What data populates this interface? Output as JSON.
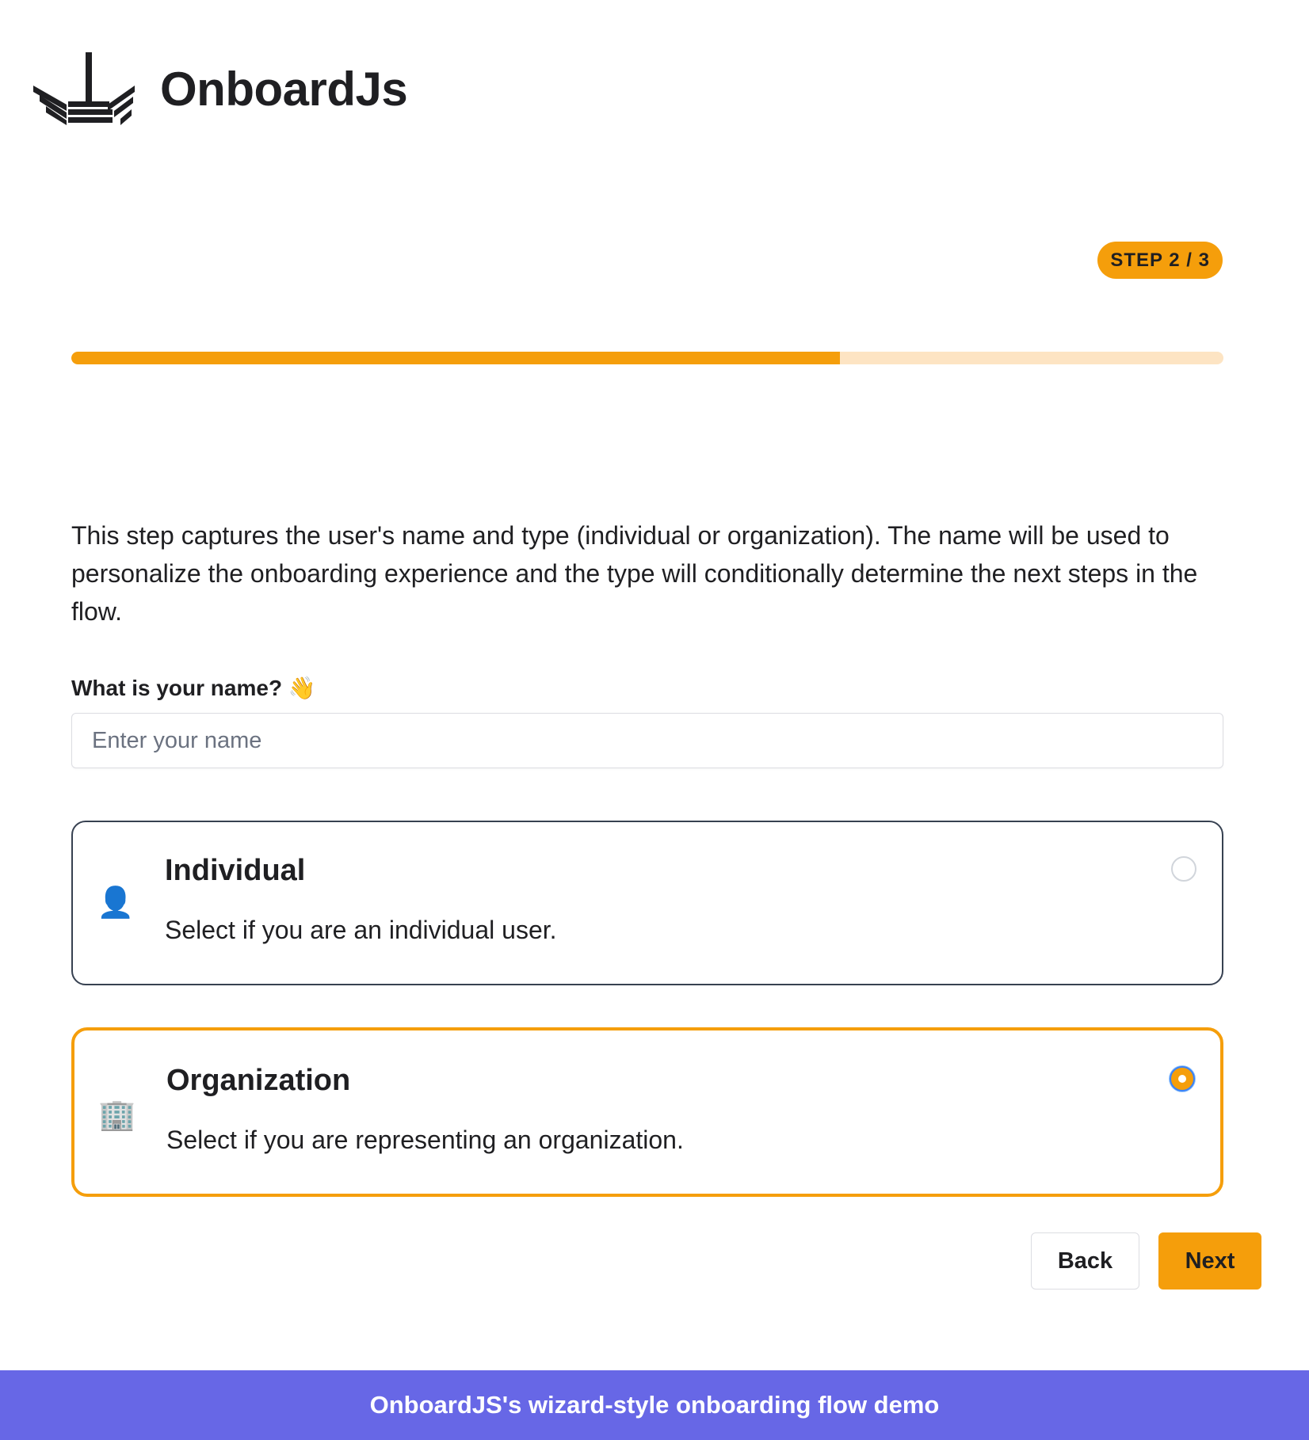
{
  "header": {
    "brand": "OnboardJs",
    "logo_icon": "ship-logo-icon"
  },
  "step": {
    "label": "STEP 2 / 3",
    "progress_fraction": 0.667
  },
  "colors": {
    "accent": "#f59e0b",
    "accent_light": "#fde4c3",
    "footer": "#6767e6",
    "text": "#1f1f22"
  },
  "description": "This step captures the user's name and type (individual or organization). The name will be used to personalize the onboarding experience and the type will conditionally determine the next steps in the flow.",
  "name_field": {
    "label": "What is your name? 👋",
    "placeholder": "Enter your name",
    "value": ""
  },
  "options": [
    {
      "icon": "👤",
      "icon_name": "person-icon",
      "title": "Individual",
      "description": "Select if you are an individual user.",
      "selected": false
    },
    {
      "icon": "🏢",
      "icon_name": "office-building-icon",
      "title": "Organization",
      "description": "Select if you are representing an organization.",
      "selected": true
    }
  ],
  "buttons": {
    "back": "Back",
    "next": "Next"
  },
  "footer": {
    "text": "OnboardJS's wizard-style onboarding flow demo"
  }
}
